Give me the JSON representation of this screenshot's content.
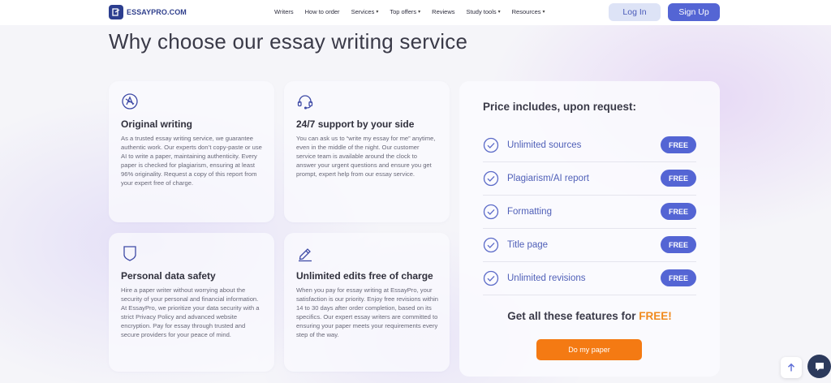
{
  "header": {
    "logo_text": "ESSAYPRO.COM",
    "nav": [
      {
        "label": "Writers",
        "dropdown": false
      },
      {
        "label": "How to order",
        "dropdown": false
      },
      {
        "label": "Services",
        "dropdown": true
      },
      {
        "label": "Top offers",
        "dropdown": true
      },
      {
        "label": "Reviews",
        "dropdown": false
      },
      {
        "label": "Study tools",
        "dropdown": true
      },
      {
        "label": "Resources",
        "dropdown": true
      }
    ],
    "login_label": "Log In",
    "signup_label": "Sign Up"
  },
  "section_title": "Why choose our essay writing service",
  "features": [
    {
      "icon": "compass-pen-icon",
      "title": "Original writing",
      "text": "As a trusted essay writing service, we guarantee authentic work. Our experts don’t copy-paste or use AI to write a paper, maintaining authenticity. Every paper is checked for plagiarism, ensuring at least 96% originality. Request a copy of this report from your expert free of charge."
    },
    {
      "icon": "headset-icon",
      "title": "24/7 support by your side",
      "text": "You can ask us to “write my essay for me” anytime, even in the middle of the night. Our customer service team is available around the clock to answer your urgent questions and ensure you get prompt, expert help from our essay service."
    },
    {
      "icon": "shield-icon",
      "title": "Personal data safety",
      "text": "Hire a paper writer without worrying about the security of your personal and financial information. At EssayPro, we prioritize your data security with a strict Privacy Policy and advanced website encryption. Pay for essay through trusted and secure providers for your peace of mind."
    },
    {
      "icon": "pencil-icon",
      "title": "Unlimited edits free of charge",
      "text": "When you pay for essay writing at EssayPro, your satisfaction is our priority. Enjoy free revisions within 14 to 30 days after order completion, based on its specifics. Our expert essay writers are committed to ensuring your paper meets your requirements every step of the way."
    }
  ],
  "price": {
    "title": "Price includes, upon request:",
    "items": [
      {
        "label": "Unlimited sources",
        "badge": "FREE"
      },
      {
        "label": "Plagiarism/AI report",
        "badge": "FREE"
      },
      {
        "label": "Formatting",
        "badge": "FREE"
      },
      {
        "label": "Title page",
        "badge": "FREE"
      },
      {
        "label": "Unlimited revisions",
        "badge": "FREE"
      }
    ],
    "cta_prefix": "Get all these features for ",
    "cta_highlight": "FREE!",
    "order_button": "Do my paper"
  },
  "widgets": {
    "scroll_top_icon": "arrow-up-icon",
    "chat_icon": "chat-icon"
  },
  "colors": {
    "accent": "#5465d4",
    "cta_orange": "#f47a13",
    "highlight_orange": "#f08a1c"
  }
}
